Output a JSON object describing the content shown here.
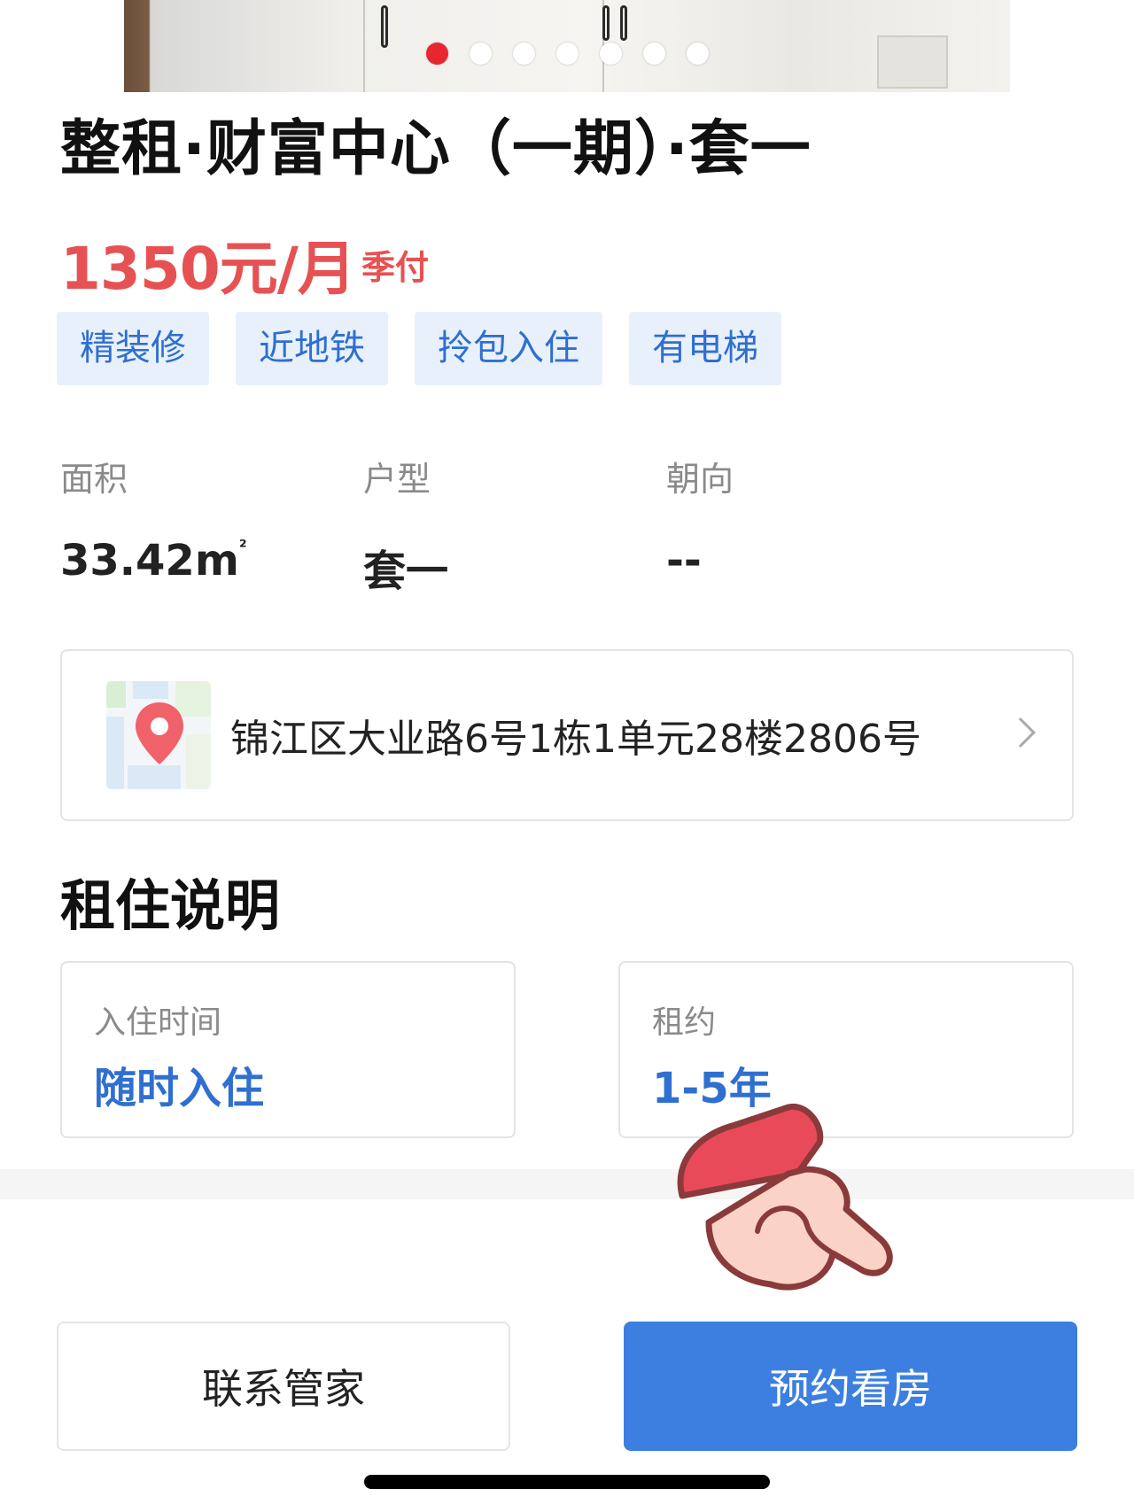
{
  "carousel": {
    "slide_count": 7,
    "active_index": 0,
    "active_color": "#e8262f",
    "dot_color": "#ffffff"
  },
  "listing": {
    "title": "整租·财富中心（一期）·套一",
    "price": "1350元/月",
    "payment": "季付",
    "tags": [
      "精装修",
      "近地铁",
      "拎包入住",
      "有电梯"
    ]
  },
  "attributes": [
    {
      "label": "面积",
      "value": "33.42m",
      "unit_sup": "²"
    },
    {
      "label": "户型",
      "value": "套一"
    },
    {
      "label": "朝向",
      "value": "--"
    }
  ],
  "address": {
    "text": "锦江区大业路6号1栋1单元28楼2806号",
    "icon": "map-pin-icon"
  },
  "rent_info": {
    "title": "租住说明",
    "move_in": {
      "label": "入住时间",
      "value": "随时入住"
    },
    "lease": {
      "label": "租约",
      "value": "1-5年"
    }
  },
  "buttons": {
    "contact": "联系管家",
    "book": "预约看房"
  },
  "colors": {
    "price": "#e65253",
    "tag_bg": "#e8f0fb",
    "tag_text": "#2f6fd0",
    "primary_button": "#3c7fe0"
  }
}
